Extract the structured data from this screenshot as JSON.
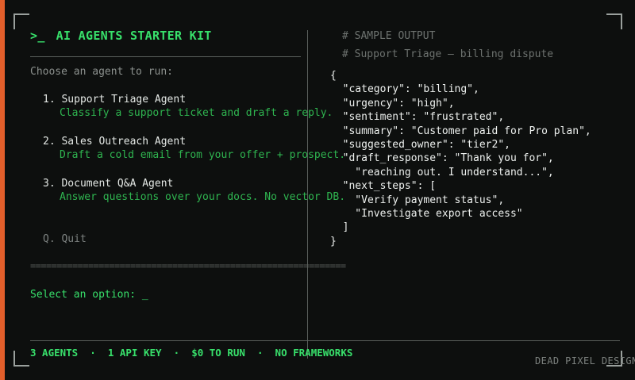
{
  "title": {
    "prompt": ">_",
    "text": "AI AGENTS STARTER KIT"
  },
  "subtitle": "Choose an agent to run:",
  "menu": [
    {
      "number": "1.",
      "name": "Support Triage Agent",
      "description": "Classify a support ticket and draft a reply."
    },
    {
      "number": "2.",
      "name": "Sales Outreach Agent",
      "description": "Draft a cold email from your offer + prospect."
    },
    {
      "number": "3.",
      "name": "Document Q&A Agent",
      "description": "Answer questions over your docs. No vector DB."
    }
  ],
  "quit_label": "Q. Quit",
  "separator": "============================================================",
  "select_prompt": "Select an option: _",
  "footer": {
    "stats": "3 AGENTS  ·  1 API KEY  ·  $0 TO RUN  ·  NO FRAMEWORKS",
    "brand": "DEAD PIXEL DESIGN"
  },
  "sample": {
    "comment1": "# SAMPLE OUTPUT",
    "comment2": "# Support Triage — billing dispute",
    "lines": [
      "{",
      "  \"category\": \"billing\",",
      "  \"urgency\": \"high\",",
      "  \"sentiment\": \"frustrated\",",
      "  \"summary\": \"Customer paid for Pro plan\",",
      "  \"suggested_owner\": \"tier2\",",
      "  \"draft_response\": \"Thank you for\",",
      "    \"reaching out. I understand...\",",
      "  \"next_steps\": [",
      "    \"Verify payment status\",",
      "    \"Investigate export access\"",
      "  ]",
      "}"
    ]
  },
  "colors": {
    "accent_bar": "#e35f2b",
    "terminal_green": "#38e06b",
    "description_green": "#2fb550",
    "background": "#0d0f0e"
  }
}
